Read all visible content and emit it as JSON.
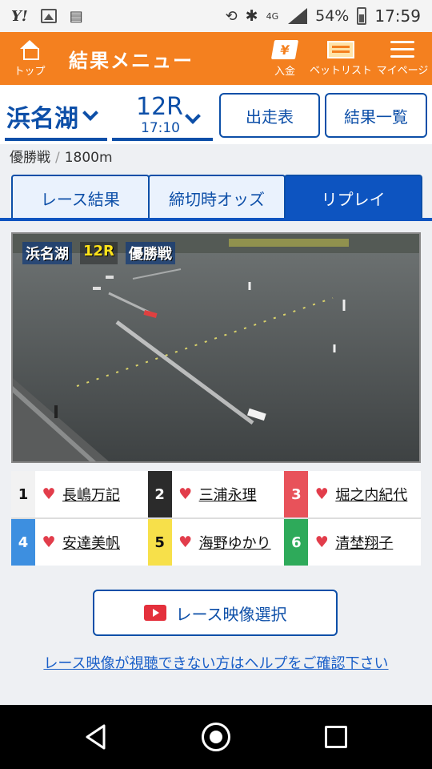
{
  "status_bar": {
    "network": "4G",
    "battery": "54%",
    "time": "17:59"
  },
  "header": {
    "title": "結果メニュー",
    "top_label": "トップ",
    "deposit_label": "入金",
    "betlist_label": "ベットリスト",
    "mypage_label": "マイページ",
    "color": "#f4801f"
  },
  "race_select": {
    "venue": "浜名湖",
    "race_no": "12R",
    "time": "17:10",
    "entries_button": "出走表",
    "results_list_button": "結果一覧"
  },
  "race_meta": {
    "grade": "優勝戦",
    "separator": "/",
    "distance": "1800m"
  },
  "tabs": [
    {
      "label": "レース結果",
      "active": false
    },
    {
      "label": "締切時オッズ",
      "active": false
    },
    {
      "label": "リプレイ",
      "active": true
    }
  ],
  "video": {
    "overlay_venue": "浜名湖",
    "overlay_race": "12R",
    "overlay_grade": "優勝戦"
  },
  "racers": [
    {
      "lane": "1",
      "name": "長嶋万記",
      "color": "#f2f2f2",
      "text_color": "#111"
    },
    {
      "lane": "2",
      "name": "三浦永理",
      "color": "#2b2b2b",
      "text_color": "#fff"
    },
    {
      "lane": "3",
      "name": "堀之内紀代",
      "color": "#e8525a",
      "text_color": "#fff"
    },
    {
      "lane": "4",
      "name": "安達美帆",
      "color": "#3d8fe0",
      "text_color": "#fff"
    },
    {
      "lane": "5",
      "name": "海野ゆかり",
      "color": "#f7e04a",
      "text_color": "#111"
    },
    {
      "lane": "6",
      "name": "清埜翔子",
      "color": "#2eaa5a",
      "text_color": "#fff"
    }
  ],
  "video_select_button": "レース映像選択",
  "help_link": "レース映像が視聴できない方はヘルプをご確認下さい"
}
